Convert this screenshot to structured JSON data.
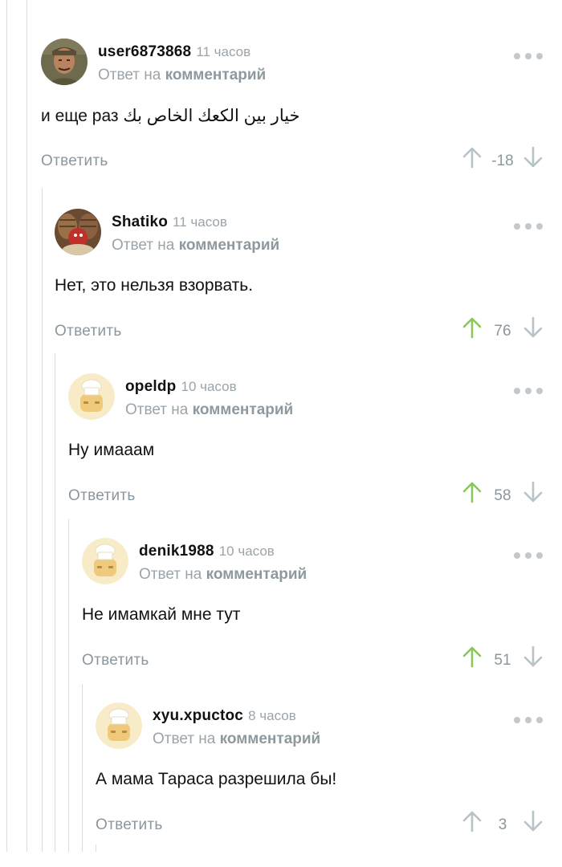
{
  "colors": {
    "upvote_active": "#8ac858",
    "upvote_inactive": "#b8c3c9",
    "muted": "#9aa4ab",
    "thread_line": "#d9dde0"
  },
  "comments": [
    {
      "username": "user6873868",
      "time": "11 часов",
      "reply_prefix": "Ответ на",
      "reply_link": "комментарий",
      "text": "и еще раз خيار بين الكعك الخاص بك",
      "reply_label": "Ответить",
      "score": "-18",
      "upvoted": false,
      "avatar": "photo-avatar"
    },
    {
      "username": "Shatiko",
      "time": "11 часов",
      "reply_prefix": "Ответ на",
      "reply_link": "комментарий",
      "text": "Нет, это нельзя взорвать.",
      "reply_label": "Ответить",
      "score": "76",
      "upvoted": true,
      "avatar": "photo-avatar"
    },
    {
      "username": "opeldp",
      "time": "10 часов",
      "reply_prefix": "Ответ на",
      "reply_link": "комментарий",
      "text": "Ну имааам",
      "reply_label": "Ответить",
      "score": "58",
      "upvoted": true,
      "avatar": "default-chef-avatar"
    },
    {
      "username": "denik1988",
      "time": "10 часов",
      "reply_prefix": "Ответ на",
      "reply_link": "комментарий",
      "text": "Не имамкай мне тут",
      "reply_label": "Ответить",
      "score": "51",
      "upvoted": true,
      "avatar": "default-chef-avatar"
    },
    {
      "username": "xyu.xpuctoc",
      "time": "8 часов",
      "reply_prefix": "Ответ на",
      "reply_link": "комментарий",
      "text": "А мама Тараса разрешила бы!",
      "reply_label": "Ответить",
      "score": "3",
      "upvoted": false,
      "avatar": "default-chef-avatar"
    }
  ]
}
